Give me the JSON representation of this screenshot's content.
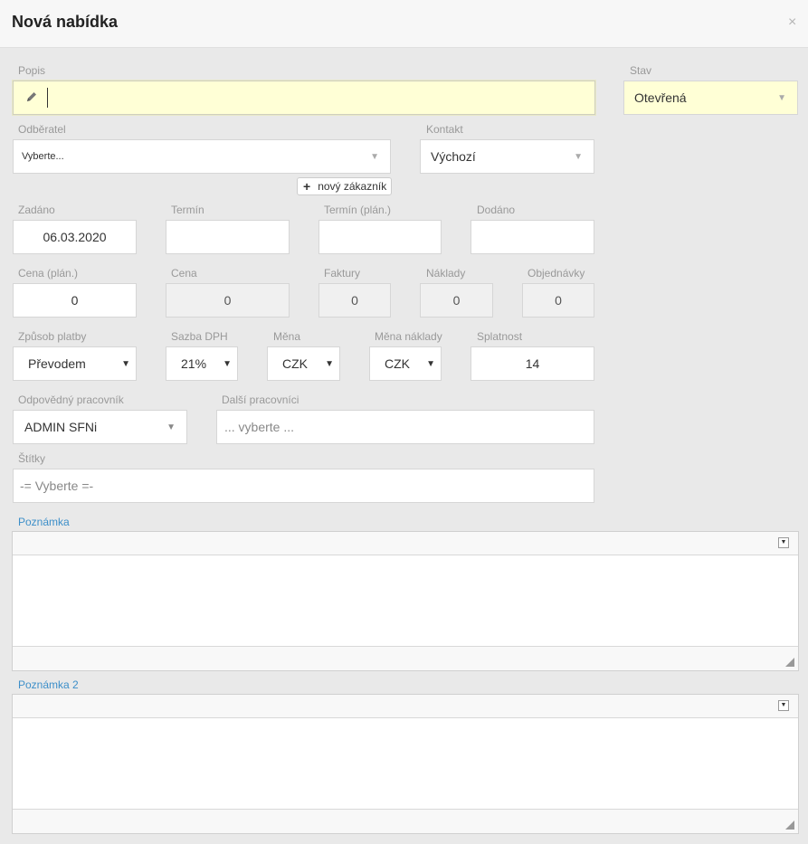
{
  "dialog": {
    "title": "Nová nabídka",
    "close": "×"
  },
  "form": {
    "popis": {
      "label": "Popis",
      "value": ""
    },
    "stav": {
      "label": "Stav",
      "value": "Otevřená"
    },
    "odberatel": {
      "label": "Odběratel",
      "value": "Vyberte..."
    },
    "kontakt": {
      "label": "Kontakt",
      "value": "Výchozí"
    },
    "new_customer": "nový zákazník",
    "zadano": {
      "label": "Zadáno",
      "value": "06.03.2020"
    },
    "termin": {
      "label": "Termín",
      "value": ""
    },
    "termin_plan": {
      "label": "Termín (plán.)",
      "value": ""
    },
    "dodano": {
      "label": "Dodáno",
      "value": ""
    },
    "cena_plan": {
      "label": "Cena (plán.)",
      "value": "0"
    },
    "cena": {
      "label": "Cena",
      "value": "0"
    },
    "faktury": {
      "label": "Faktury",
      "value": "0"
    },
    "naklady": {
      "label": "Náklady",
      "value": "0"
    },
    "objednavky": {
      "label": "Objednávky",
      "value": "0"
    },
    "zpusob_platby": {
      "label": "Způsob platby",
      "value": "Převodem"
    },
    "sazba_dph": {
      "label": "Sazba DPH",
      "value": "21%"
    },
    "mena": {
      "label": "Měna",
      "value": "CZK"
    },
    "mena_naklady": {
      "label": "Měna náklady",
      "value": "CZK"
    },
    "splatnost": {
      "label": "Splatnost",
      "value": "14"
    },
    "odpovedny": {
      "label": "Odpovědný pracovník",
      "value": "ADMIN SFNi"
    },
    "dalsi": {
      "label": "Další pracovníci",
      "placeholder": "... vyberte ..."
    },
    "stitky": {
      "label": "Štítky",
      "placeholder": "-= Vyberte =-"
    },
    "poznamka": {
      "label": "Poznámka"
    },
    "poznamka2": {
      "label": "Poznámka 2"
    }
  },
  "icons": {
    "pencil": "pencil-icon",
    "caret": "caret-down-icon",
    "plus": "plus-icon"
  },
  "colors": {
    "highlight": "#ffffd6",
    "link_label": "#3d8fc9",
    "background": "#e9e9e9"
  }
}
